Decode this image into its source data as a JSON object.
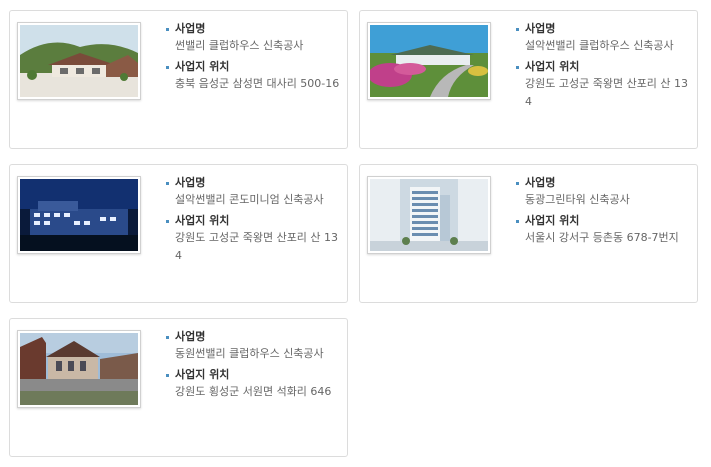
{
  "labels": {
    "project_name": "사업명",
    "project_location": "사업지 위치"
  },
  "projects": [
    {
      "name": "썬밸리 클럽하우스 신축공사",
      "location": "충북 음성군 삼성면 대사리 500-16",
      "icon": "clubhouse-photo"
    },
    {
      "name": "설악썬밸리 클럽하우스 신축공사",
      "location": "강원도 고성군 죽왕면 산포리 산 134",
      "icon": "clubhouse-garden-photo"
    },
    {
      "name": "설악썬밸리 콘도미니엄 신축공사",
      "location": "강원도 고성군 죽왕면 산포리 산 134",
      "icon": "condominium-night-photo"
    },
    {
      "name": "동광그린타워 신축공사",
      "location": "서울시 강서구 등촌동 678-7번지",
      "icon": "office-tower-photo"
    },
    {
      "name": "동원썬밸리 클럽하우스 신축공사",
      "location": "강원도 횡성군 서원면 석화리 646",
      "icon": "clubhouse-dusk-photo"
    }
  ]
}
